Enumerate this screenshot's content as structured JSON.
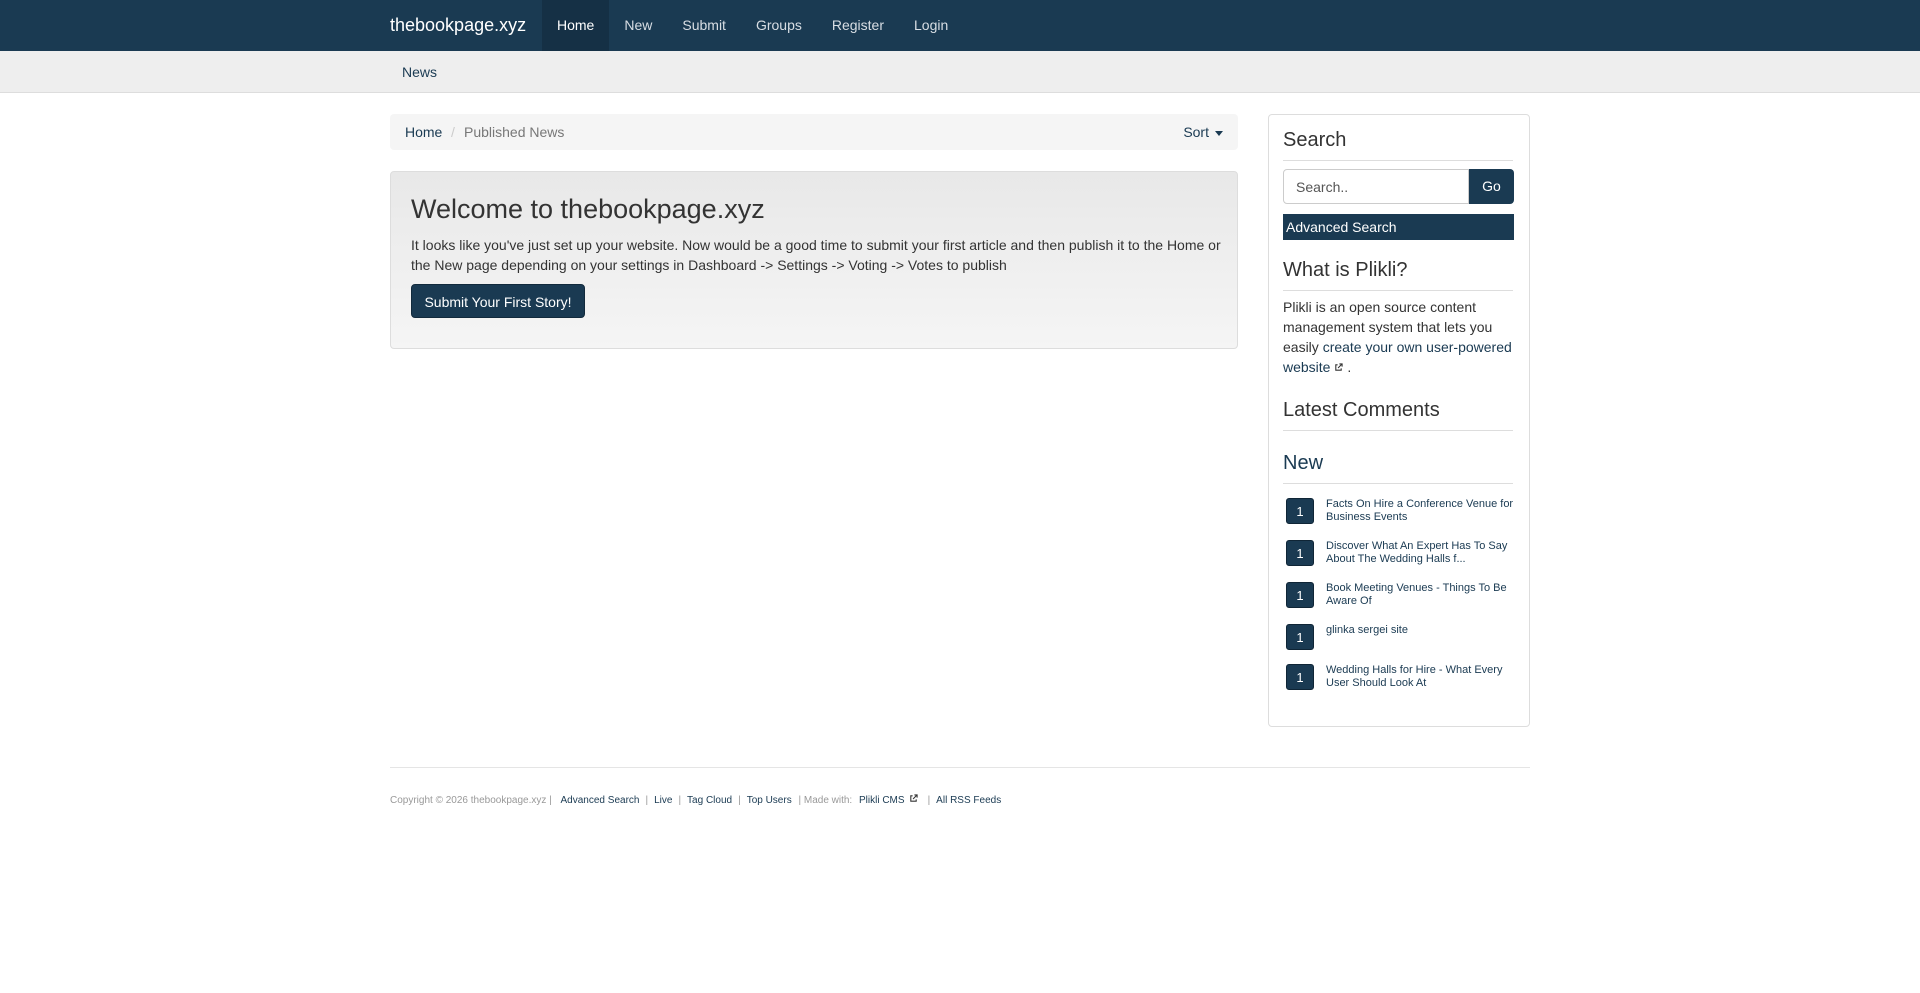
{
  "navbar": {
    "brand": "thebookpage.xyz",
    "items": [
      {
        "label": "Home",
        "active": true
      },
      {
        "label": "New"
      },
      {
        "label": "Submit"
      },
      {
        "label": "Groups"
      },
      {
        "label": "Register"
      },
      {
        "label": "Login"
      }
    ]
  },
  "subbar": {
    "link": "News"
  },
  "breadcrumb": {
    "home": "Home",
    "separator": "/",
    "current": "Published News",
    "sort": "Sort"
  },
  "welcome": {
    "title": "Welcome to thebookpage.xyz",
    "text": "It looks like you've just set up your website. Now would be a good time to submit your first article and then publish it to the Home or the New page depending on your settings in Dashboard -> Settings -> Voting -> Votes to publish",
    "button": "Submit Your First Story!"
  },
  "sidebar": {
    "search_heading": "Search",
    "search_placeholder": "Search..",
    "go_label": "Go",
    "advanced_search": "Advanced Search",
    "about_heading": "What is Plikli?",
    "about_text": "Plikli is an open source content management system that lets you easily ",
    "about_link": "create your own user-powered website",
    "about_end": " .",
    "comments_heading": "Latest Comments",
    "new_heading": "New",
    "new_items": [
      {
        "votes": "1",
        "title": "Facts On Hire a Conference Venue for Business Events"
      },
      {
        "votes": "1",
        "title": "Discover What An Expert Has To Say About The Wedding Halls f..."
      },
      {
        "votes": "1",
        "title": "Book Meeting Venues - Things To Be Aware Of"
      },
      {
        "votes": "1",
        "title": "glinka sergei site"
      },
      {
        "votes": "1",
        "title": "Wedding Halls for Hire - What Every User Should Look At"
      }
    ]
  },
  "footer": {
    "copyright": "Copyright © 2026 thebookpage.xyz |",
    "links": [
      "Advanced Search",
      "Live",
      "Tag Cloud",
      "Top Users"
    ],
    "made_with": "| Made with:",
    "cms_link": "Plikli CMS",
    "rss": "All RSS Feeds"
  },
  "colors": {
    "accent": "#1a3a52",
    "navbar": "#1a3a52",
    "subbar": "#eeeeee"
  }
}
